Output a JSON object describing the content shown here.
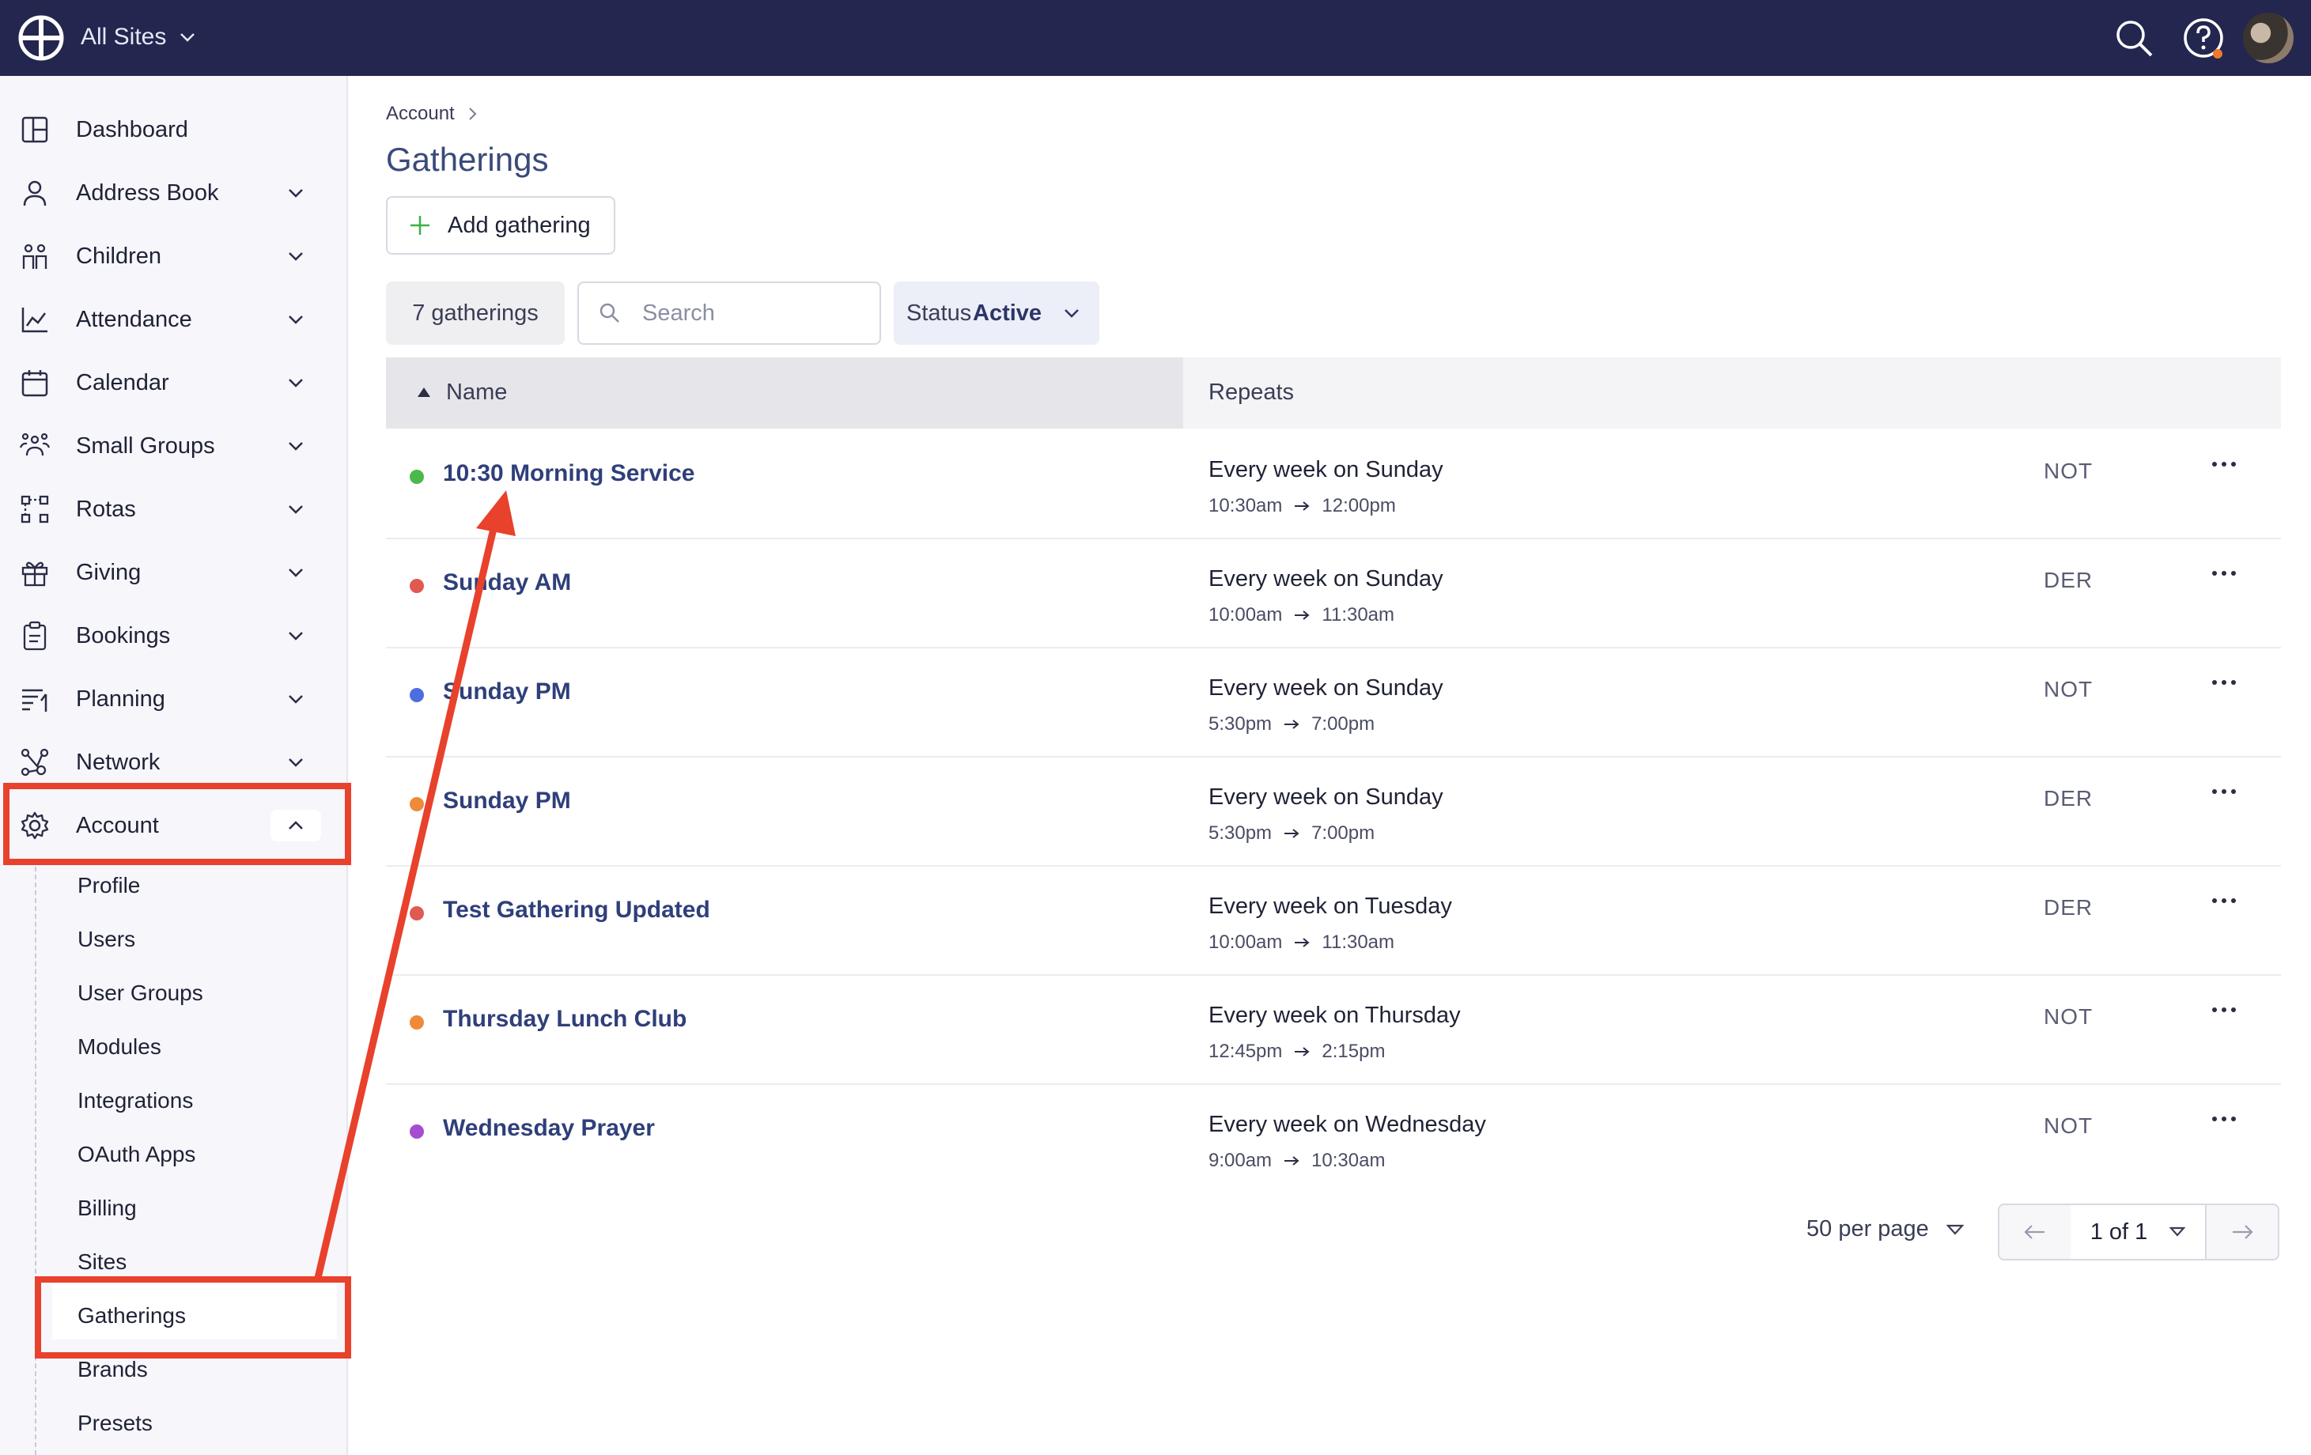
{
  "topbar": {
    "sites_label": "All Sites"
  },
  "sidebar": {
    "items": [
      {
        "label": "Dashboard",
        "icon": "dashboard-icon"
      },
      {
        "label": "Address Book",
        "icon": "person-icon"
      },
      {
        "label": "Children",
        "icon": "children-icon"
      },
      {
        "label": "Attendance",
        "icon": "chart-icon"
      },
      {
        "label": "Calendar",
        "icon": "calendar-icon"
      },
      {
        "label": "Small Groups",
        "icon": "groups-icon"
      },
      {
        "label": "Rotas",
        "icon": "rotas-icon"
      },
      {
        "label": "Giving",
        "icon": "gift-icon"
      },
      {
        "label": "Bookings",
        "icon": "clipboard-icon"
      },
      {
        "label": "Planning",
        "icon": "planning-icon"
      },
      {
        "label": "Network",
        "icon": "network-icon"
      },
      {
        "label": "Account",
        "icon": "gear-icon"
      }
    ],
    "account_sub": [
      "Profile",
      "Users",
      "User Groups",
      "Modules",
      "Integrations",
      "OAuth Apps",
      "Billing",
      "Sites",
      "Gatherings",
      "Brands",
      "Presets"
    ],
    "active_sub": "Gatherings"
  },
  "main": {
    "breadcrumb": "Account",
    "title": "Gatherings",
    "add_button": "Add gathering",
    "count": "7 gatherings",
    "search_placeholder": "Search",
    "status_key": "Status",
    "status_value": "Active",
    "columns": {
      "name": "Name",
      "repeats": "Repeats"
    },
    "rows": [
      {
        "name": "10:30 Morning Service",
        "dot": "#4cb84c",
        "repeats": "Every week on Sunday",
        "start": "10:30am",
        "end": "12:00pm",
        "tag": "NOT"
      },
      {
        "name": "Sunday AM",
        "dot": "#e05a4f",
        "repeats": "Every week on Sunday",
        "start": "10:00am",
        "end": "11:30am",
        "tag": "DER"
      },
      {
        "name": "Sunday PM",
        "dot": "#4d6ee0",
        "repeats": "Every week on Sunday",
        "start": "5:30pm",
        "end": "7:00pm",
        "tag": "NOT"
      },
      {
        "name": "Sunday PM",
        "dot": "#ee8a3a",
        "repeats": "Every week on Sunday",
        "start": "5:30pm",
        "end": "7:00pm",
        "tag": "DER"
      },
      {
        "name": "Test Gathering Updated",
        "dot": "#e05a4f",
        "repeats": "Every week on Tuesday",
        "start": "10:00am",
        "end": "11:30am",
        "tag": "DER"
      },
      {
        "name": "Thursday Lunch Club",
        "dot": "#ee8a3a",
        "repeats": "Every week on Thursday",
        "start": "12:45pm",
        "end": "2:15pm",
        "tag": "NOT"
      },
      {
        "name": "Wednesday Prayer",
        "dot": "#a54ed0",
        "repeats": "Every week on Wednesday",
        "start": "9:00am",
        "end": "10:30am",
        "tag": "NOT"
      }
    ],
    "per_page": "50 per page",
    "page": "1 of 1"
  },
  "colors": {
    "topbar": "#23264f",
    "accent_text": "#2f3f7a",
    "highlight": "#e8412c"
  }
}
